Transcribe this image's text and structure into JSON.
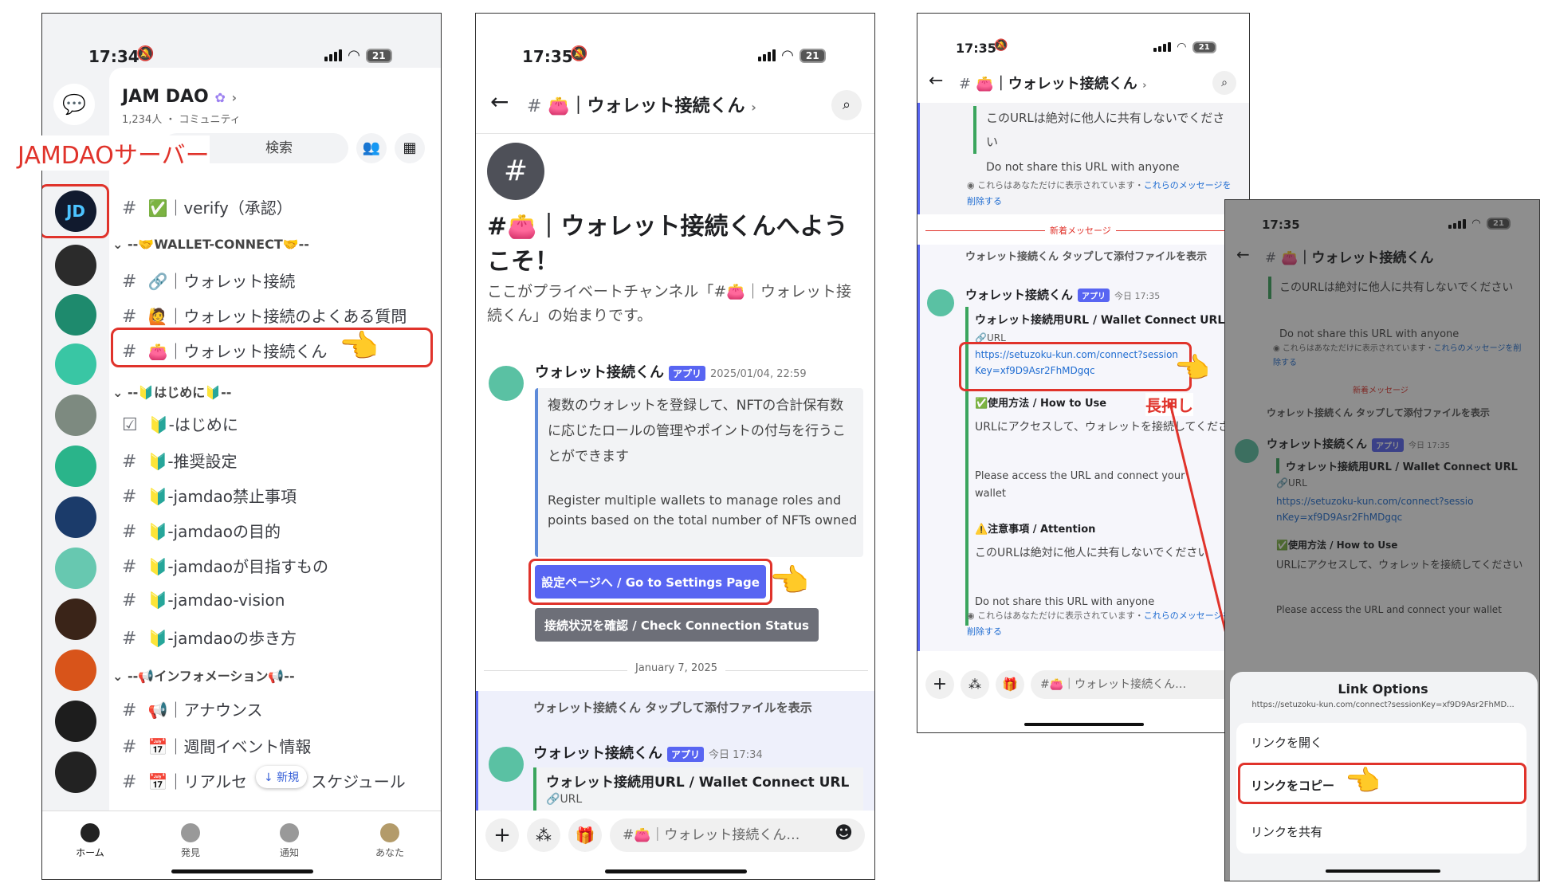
{
  "annotations": {
    "server_label": "JAMDAOサーバー",
    "long_press": "長押し"
  },
  "phone1": {
    "time": "17:34",
    "battery": "21",
    "server_name": "JAM DAO",
    "member_count": "1,234人",
    "community": "コミュニティ",
    "search_label": "検索",
    "channels": {
      "verify": "✅｜verify（承認）",
      "cat_wallet": "--🤝WALLET-CONNECT🤝--",
      "wallet_connect": "🔗｜ウォレット接続",
      "wallet_faq": "🙋｜ウォレット接続のよくある質問",
      "wallet_kun": "👛｜ウォレット接続くん",
      "cat_start": "--🔰はじめに🔰--",
      "hajimeni": "🔰-はじめに",
      "recommend": "🔰-推奨設定",
      "prohibited": "🔰-jamdao禁止事項",
      "purpose": "🔰-jamdaoの目的",
      "goal": "🔰-jamdaoが目指すもの",
      "vision": "🔰-jamdao-vision",
      "walk": "🔰-jamdaoの歩き方",
      "cat_info": "--📢インフォメーション📢--",
      "announce": "📢｜アナウンス",
      "weekly": "📅｜週間イベント情報",
      "real": "📅｜リアルセ",
      "real_end": "スケジュール",
      "new_badge": "↓ 新規"
    },
    "tabs": [
      "ホーム",
      "発見",
      "通知",
      "あなた"
    ]
  },
  "phone2": {
    "time": "17:35",
    "battery": "21",
    "channel": "👛｜ウォレット接続くん",
    "welcome_title": "#👛｜ウォレット接続くんへようこそ！",
    "welcome_sub": "ここがプライベートチャンネル「#👛｜ウォレット接続くん」の始まりです。",
    "bot_name": "ウォレット接続くん",
    "app_badge": "アプリ",
    "msg_time": "2025/01/04, 22:59",
    "embed_jp": "複数のウォレットを登録して、NFTの合計保有数に応じたロールの管理やポイントの付与を行うことができます",
    "embed_en": "Register multiple wallets to manage roles and points based on the total number of NFTs owned",
    "btn_settings": "設定ページへ / Go to Settings Page",
    "btn_status": "接続状況を確認 / Check Connection Status",
    "date_divider": "January 7, 2025",
    "reply_text": "ウォレット接続くん タップして添付ファイルを表示",
    "msg2_time": "今日 17:34",
    "embed2_title": "ウォレット接続用URL / Wallet Connect URL",
    "url_label": "URL",
    "input_placeholder": "#👛｜ウォレット接続くん…"
  },
  "phone3": {
    "time": "17:35",
    "battery": "21",
    "channel": "👛｜ウォレット接続くん",
    "top_jp": "このURLは絶対に他人に共有しないでください",
    "top_en": "Do not share this URL with anyone",
    "ephemeral": "これらはあなただけに表示されています・",
    "ephemeral_link": "これらのメッセージを削除する",
    "new_msg": "新着メッセージ",
    "reply_text": "ウォレット接続くん タップして添付ファイルを表示",
    "bot_name": "ウォレット接続くん",
    "app_badge": "アプリ",
    "msg_time": "今日 17:35",
    "embed_title": "ウォレット接続用URL / Wallet Connect URL",
    "url_label": "URL",
    "url": "https://setuzoku-kun.com/connect?sessionKey=xf9D9Asr2FhMDgqc",
    "usage_title": "✅使用方法 / How to Use",
    "usage_jp": "URLにアクセスして、ウォレットを接続してください",
    "usage_en": "Please access the URL and connect your wallet",
    "caution_title": "⚠️注意事項 / Attention",
    "caution_jp": "このURLは絶対に他人に共有しないでください",
    "caution_en": "Do not share this URL with anyone",
    "input_placeholder": "#👛｜ウォレット接続くん…"
  },
  "phone4": {
    "time": "17:35",
    "battery": "21",
    "channel": "👛｜ウォレット接続くん",
    "top_jp": "このURLは絶対に他人に共有しないでください",
    "top_en": "Do not share this URL with anyone",
    "ephemeral": "これらはあなただけに表示されています・",
    "ephemeral_link": "これらのメッセージを削除する",
    "new_msg": "新着メッセージ",
    "reply_text": "ウォレット接続くん タップして添付ファイルを表示",
    "bot_name": "ウォレット接続くん",
    "app_badge": "アプリ",
    "msg_time": "今日 17:35",
    "embed_title": "ウォレット接続用URL / Wallet Connect URL",
    "url_label": "URL",
    "url": "https://setuzoku-kun.com/connect?sessionKey=xf9D9Asr2FhMDgqc",
    "usage_title": "✅使用方法 / How to Use",
    "usage_jp": "URLにアクセスして、ウォレットを接続してください",
    "usage_en": "Please access the URL and connect your wallet",
    "sheet_title": "Link Options",
    "sheet_url": "https://setuzoku-kun.com/connect?sessionKey=xf9D9Asr2FhMD...",
    "opt_open": "リンクを開く",
    "opt_copy": "リンクをコピー",
    "opt_share": "リンクを共有"
  },
  "colors": {
    "annotation_red": "#e0332b",
    "blurple": "#5865f2",
    "link": "#1f6cd1"
  }
}
